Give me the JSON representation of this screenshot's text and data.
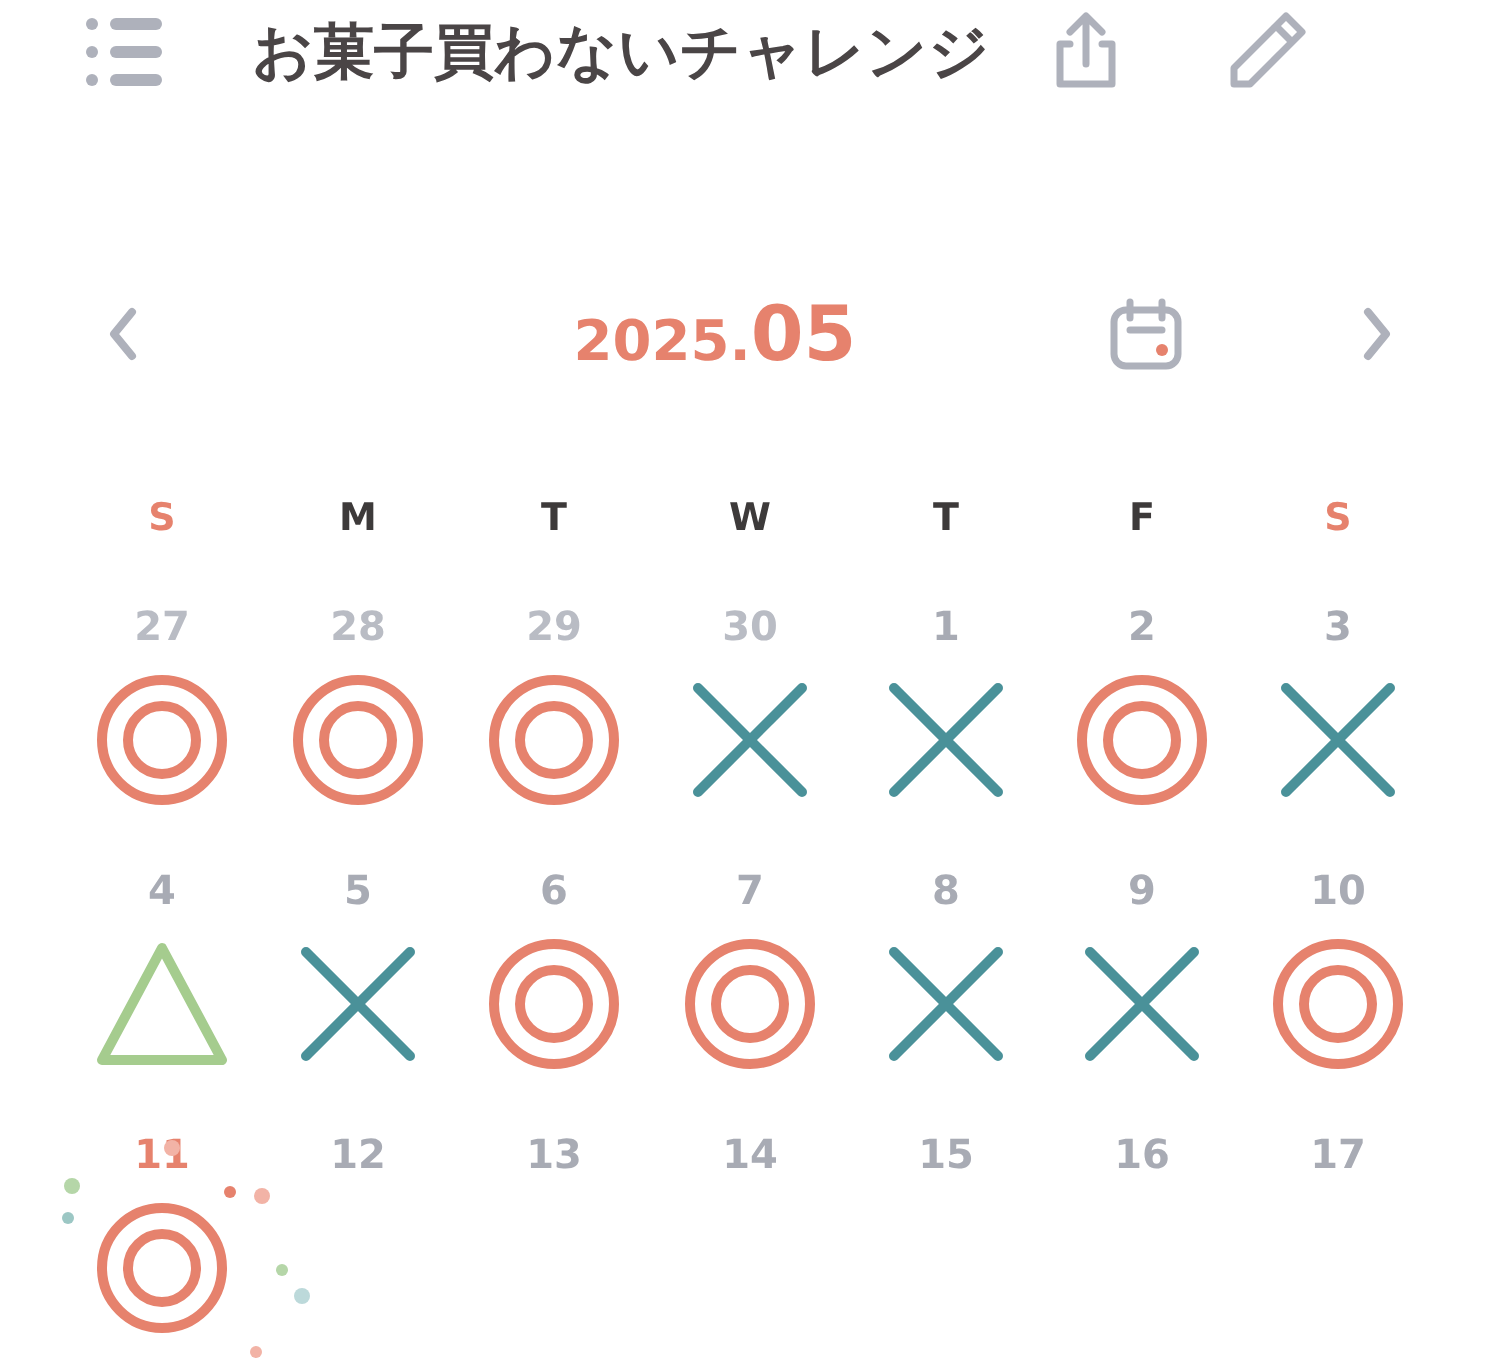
{
  "header": {
    "title": "お菓子買わないチャレンジ"
  },
  "nav": {
    "year": "2025.",
    "month": "05"
  },
  "weekdays": [
    {
      "label": "S",
      "weekend": true
    },
    {
      "label": "M",
      "weekend": false
    },
    {
      "label": "T",
      "weekend": false
    },
    {
      "label": "W",
      "weekend": false
    },
    {
      "label": "T",
      "weekend": false
    },
    {
      "label": "F",
      "weekend": false
    },
    {
      "label": "S",
      "weekend": true
    }
  ],
  "days": [
    {
      "number": "27",
      "other_month": true,
      "today": false,
      "kind": "circle"
    },
    {
      "number": "28",
      "other_month": true,
      "today": false,
      "kind": "circle"
    },
    {
      "number": "29",
      "other_month": true,
      "today": false,
      "kind": "circle"
    },
    {
      "number": "30",
      "other_month": true,
      "today": false,
      "kind": "cross"
    },
    {
      "number": "1",
      "other_month": false,
      "today": false,
      "kind": "cross"
    },
    {
      "number": "2",
      "other_month": false,
      "today": false,
      "kind": "circle"
    },
    {
      "number": "3",
      "other_month": false,
      "today": false,
      "kind": "cross"
    },
    {
      "number": "4",
      "other_month": false,
      "today": false,
      "kind": "triangle"
    },
    {
      "number": "5",
      "other_month": false,
      "today": false,
      "kind": "cross"
    },
    {
      "number": "6",
      "other_month": false,
      "today": false,
      "kind": "circle"
    },
    {
      "number": "7",
      "other_month": false,
      "today": false,
      "kind": "circle"
    },
    {
      "number": "8",
      "other_month": false,
      "today": false,
      "kind": "cross"
    },
    {
      "number": "9",
      "other_month": false,
      "today": false,
      "kind": "cross"
    },
    {
      "number": "10",
      "other_month": false,
      "today": false,
      "kind": "circle"
    },
    {
      "number": "11",
      "other_month": false,
      "today": true,
      "kind": "circle"
    },
    {
      "number": "12",
      "other_month": false,
      "today": false
    },
    {
      "number": "13",
      "other_month": false,
      "today": false
    },
    {
      "number": "14",
      "other_month": false,
      "today": false
    },
    {
      "number": "15",
      "other_month": false,
      "today": false
    },
    {
      "number": "16",
      "other_month": false,
      "today": false
    },
    {
      "number": "17",
      "other_month": false,
      "today": false
    }
  ]
}
